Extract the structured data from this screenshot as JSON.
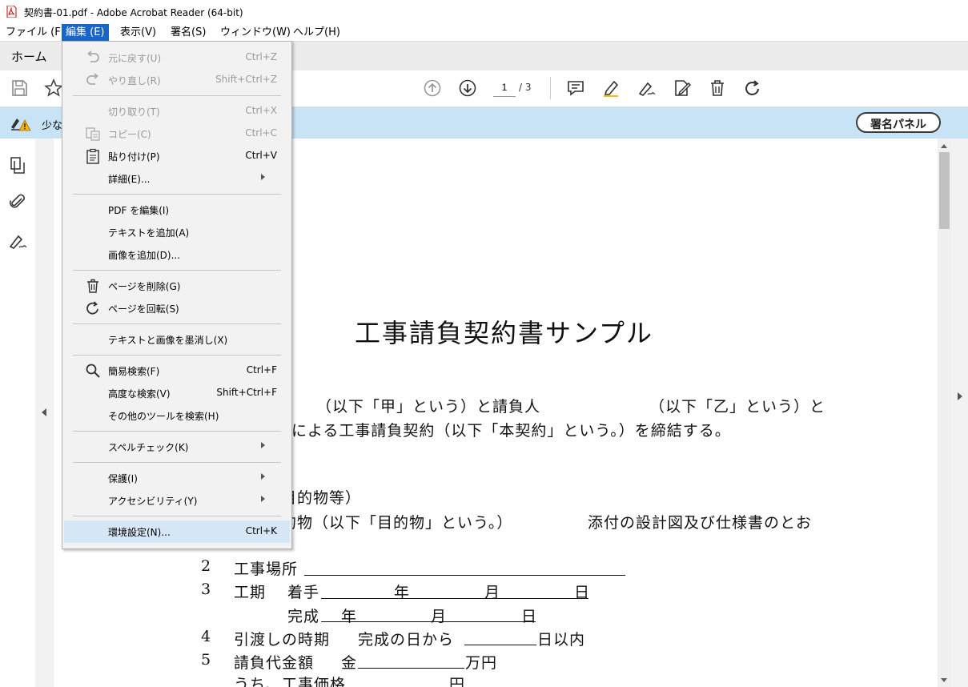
{
  "window": {
    "title": "契約書-01.pdf - Adobe Acrobat Reader (64-bit)"
  },
  "menubar": {
    "items": [
      {
        "label": "ファイル (F)"
      },
      {
        "label": "編集 (E)"
      },
      {
        "label": "表示(V)"
      },
      {
        "label": "署名(S)"
      },
      {
        "label": "ウィンドウ(W)"
      },
      {
        "label": "ヘルプ(H)"
      }
    ]
  },
  "tabs": {
    "home": "ホーム"
  },
  "toolbar": {
    "page_current": "1",
    "page_total": "/ 3"
  },
  "notice": {
    "text": "少な",
    "sign_panel_button": "署名パネル"
  },
  "edit_menu": {
    "undo": {
      "label": "元に戻す(U)",
      "shortcut": "Ctrl+Z"
    },
    "redo": {
      "label": "やり直し(R)",
      "shortcut": "Shift+Ctrl+Z"
    },
    "cut": {
      "label": "切り取り(T)",
      "shortcut": "Ctrl+X"
    },
    "copy": {
      "label": "コピー(C)",
      "shortcut": "Ctrl+C"
    },
    "paste": {
      "label": "貼り付け(P)",
      "shortcut": "Ctrl+V"
    },
    "more": {
      "label": "詳細(E)..."
    },
    "edit_pdf": {
      "label": "PDF を編集(I)"
    },
    "add_text": {
      "label": "テキストを追加(A)"
    },
    "add_image": {
      "label": "画像を追加(D)..."
    },
    "delete_page": {
      "label": "ページを削除(G)"
    },
    "rotate_page": {
      "label": "ページを回転(S)"
    },
    "redact": {
      "label": "テキストと画像を墨消し(X)"
    },
    "find": {
      "label": "簡易検索(F)",
      "shortcut": "Ctrl+F"
    },
    "advanced_search": {
      "label": "高度な検索(V)",
      "shortcut": "Shift+Ctrl+F"
    },
    "search_tools": {
      "label": "その他のツールを検索(H)"
    },
    "spell_check": {
      "label": "スペルチェック(K)"
    },
    "protection": {
      "label": "保護(I)"
    },
    "accessibility": {
      "label": "アクセシビリティ(Y)"
    },
    "preferences": {
      "label": "環境設定(N)...",
      "shortcut": "Ctrl+K"
    }
  },
  "document": {
    "title": "工事請負契約書サンプル",
    "line1a": "（以下「甲」という）と請負人",
    "line1b": "（以下「乙」という）と",
    "line2": "による工事請負契約（以下「本契約」という。）を締結する。",
    "line3": "の目的物等）",
    "line4a": "目的物（以下「目的物」という。）",
    "line4b": "添付の設計図及び仕様書のとお",
    "item2_num": "2",
    "item2_label": "工事場所",
    "item3_num": "3",
    "item3_label": "工期",
    "item3_start": "着手",
    "year": "年",
    "month": "月",
    "day": "日",
    "item3_finish": "完成",
    "item4_num": "4",
    "item4_label": "引渡しの時期",
    "item4_text": "完成の日から",
    "item4_suffix": "日以内",
    "item5_num": "5",
    "item5_label": "請負代金額",
    "item5_text": "金",
    "item5_suffix": "万円",
    "item6_label": "うち、工事価格",
    "item6_suffix": "円"
  }
}
